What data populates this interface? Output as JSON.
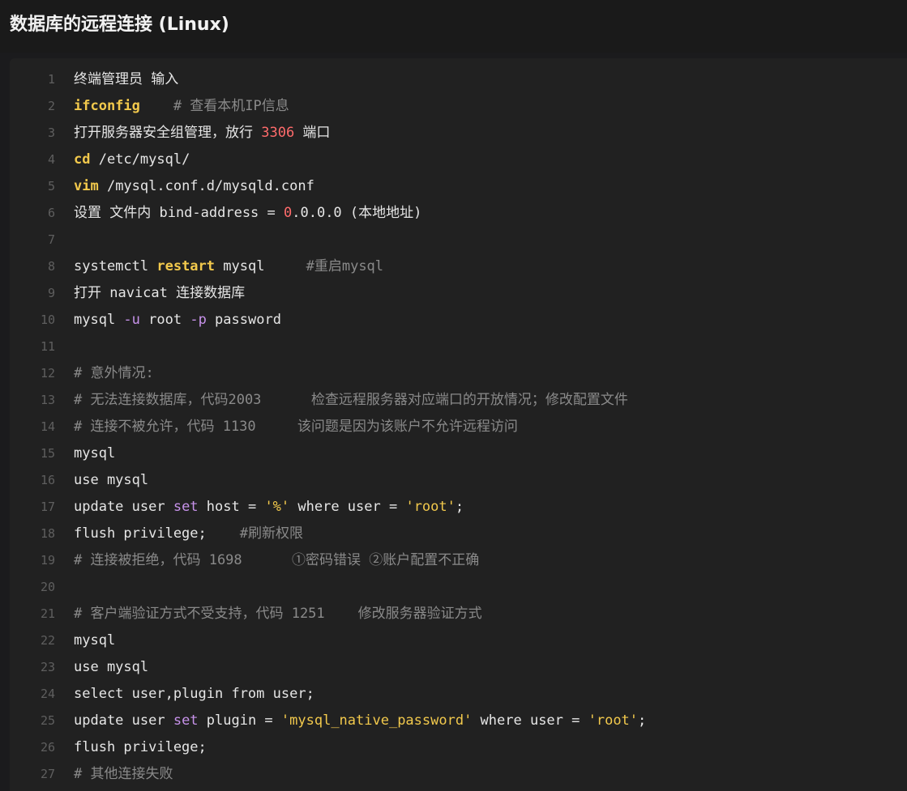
{
  "page": {
    "title": "数据库的远程连接 (Linux)"
  },
  "colors": {
    "background": "#1b1b1d",
    "code_background": "#212121",
    "line_number": "#5f5f5f",
    "text": "#e6e6e6",
    "keyword": "#f2c94c",
    "flag": "#c792ea",
    "number": "#ff6b6b",
    "comment": "#8a8a8a"
  },
  "code": {
    "lines": [
      {
        "n": "1",
        "segs": [
          {
            "t": "终端管理员 输入",
            "c": ""
          }
        ]
      },
      {
        "n": "2",
        "segs": [
          {
            "t": "ifconfig",
            "c": "k"
          },
          {
            "t": "    # 查看本机IP信息",
            "c": "c"
          }
        ]
      },
      {
        "n": "3",
        "segs": [
          {
            "t": "打开服务器安全组管理，放行 ",
            "c": ""
          },
          {
            "t": "3306",
            "c": "n"
          },
          {
            "t": " 端口",
            "c": ""
          }
        ]
      },
      {
        "n": "4",
        "segs": [
          {
            "t": "cd",
            "c": "k"
          },
          {
            "t": " /etc/mysql/",
            "c": ""
          }
        ]
      },
      {
        "n": "5",
        "segs": [
          {
            "t": "vim",
            "c": "k"
          },
          {
            "t": " /mysql.conf.d/mysqld.conf",
            "c": ""
          }
        ]
      },
      {
        "n": "6",
        "segs": [
          {
            "t": "设置 文件内 bind-address = ",
            "c": ""
          },
          {
            "t": "0",
            "c": "n"
          },
          {
            "t": ".0.0.0 (本地地址)",
            "c": ""
          }
        ]
      },
      {
        "n": "7",
        "segs": []
      },
      {
        "n": "8",
        "segs": [
          {
            "t": "systemctl ",
            "c": ""
          },
          {
            "t": "restart",
            "c": "k"
          },
          {
            "t": " mysql",
            "c": ""
          },
          {
            "t": "     #重启mysql",
            "c": "c"
          }
        ]
      },
      {
        "n": "9",
        "segs": [
          {
            "t": "打开 navicat 连接数据库",
            "c": ""
          }
        ]
      },
      {
        "n": "10",
        "segs": [
          {
            "t": "mysql ",
            "c": ""
          },
          {
            "t": "-u",
            "c": "f"
          },
          {
            "t": " root ",
            "c": ""
          },
          {
            "t": "-p",
            "c": "f"
          },
          {
            "t": " password",
            "c": ""
          }
        ]
      },
      {
        "n": "11",
        "segs": []
      },
      {
        "n": "12",
        "segs": [
          {
            "t": "# 意外情况:",
            "c": "c"
          }
        ]
      },
      {
        "n": "13",
        "segs": [
          {
            "t": "# 无法连接数据库，代码2003      检查远程服务器对应端口的开放情况；修改配置文件",
            "c": "c"
          }
        ]
      },
      {
        "n": "14",
        "segs": [
          {
            "t": "# 连接不被允许，代码 1130     该问题是因为该账户不允许远程访问",
            "c": "c"
          }
        ]
      },
      {
        "n": "15",
        "segs": [
          {
            "t": "mysql",
            "c": ""
          }
        ]
      },
      {
        "n": "16",
        "segs": [
          {
            "t": "use mysql",
            "c": ""
          }
        ]
      },
      {
        "n": "17",
        "segs": [
          {
            "t": "update user ",
            "c": ""
          },
          {
            "t": "set",
            "c": "f"
          },
          {
            "t": " host = ",
            "c": ""
          },
          {
            "t": "'%'",
            "c": "s"
          },
          {
            "t": " where user = ",
            "c": ""
          },
          {
            "t": "'root'",
            "c": "s"
          },
          {
            "t": ";",
            "c": ""
          }
        ]
      },
      {
        "n": "18",
        "segs": [
          {
            "t": "flush privilege;",
            "c": ""
          },
          {
            "t": "    #刷新权限",
            "c": "c"
          }
        ]
      },
      {
        "n": "19",
        "segs": [
          {
            "t": "# 连接被拒绝，代码 1698      ①密码错误 ②账户配置不正确",
            "c": "c"
          }
        ]
      },
      {
        "n": "20",
        "segs": []
      },
      {
        "n": "21",
        "segs": [
          {
            "t": "# 客户端验证方式不受支持，代码 1251    修改服务器验证方式",
            "c": "c"
          }
        ]
      },
      {
        "n": "22",
        "segs": [
          {
            "t": "mysql",
            "c": ""
          }
        ]
      },
      {
        "n": "23",
        "segs": [
          {
            "t": "use mysql",
            "c": ""
          }
        ]
      },
      {
        "n": "24",
        "segs": [
          {
            "t": "select user,plugin from user;",
            "c": ""
          }
        ]
      },
      {
        "n": "25",
        "segs": [
          {
            "t": "update user ",
            "c": ""
          },
          {
            "t": "set",
            "c": "f"
          },
          {
            "t": " plugin = ",
            "c": ""
          },
          {
            "t": "'mysql_native_password'",
            "c": "s"
          },
          {
            "t": " where user = ",
            "c": ""
          },
          {
            "t": "'root'",
            "c": "s"
          },
          {
            "t": ";",
            "c": ""
          }
        ]
      },
      {
        "n": "26",
        "segs": [
          {
            "t": "flush privilege;",
            "c": ""
          }
        ]
      },
      {
        "n": "27",
        "segs": [
          {
            "t": "# 其他连接失败",
            "c": "c"
          }
        ]
      }
    ]
  }
}
